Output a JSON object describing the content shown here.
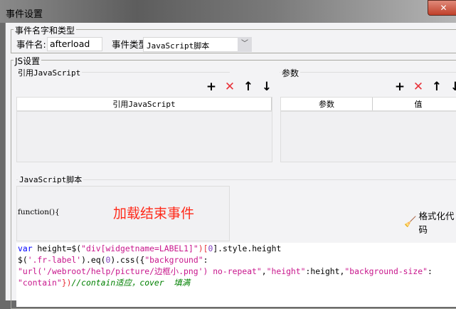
{
  "window": {
    "title": "事件设置",
    "close": "✕"
  },
  "event_group": {
    "title": "事件名字和类型",
    "name_label": "事件名:",
    "name_value": "afterload",
    "type_label": "事件类型:",
    "type_value": "JavaScript脚本"
  },
  "js_group": {
    "title": "JS设置",
    "ref_section": {
      "title": "引用JavaScript",
      "column": "引用JavaScript"
    },
    "param_section": {
      "title": "参数",
      "columns": [
        "参数",
        "值"
      ]
    },
    "toolbar": {
      "add": "+",
      "delete": "✕",
      "up": "↑",
      "down": "↓"
    },
    "script_section": {
      "title": "JavaScript脚本",
      "function_header": "function(){",
      "annotation": "加载结束事件",
      "format_button": "格式化代码"
    }
  },
  "code": {
    "l1": [
      "var",
      " height=$(",
      "\"div[widgetname=LABEL1]\"",
      ")[",
      "0",
      "].style.height"
    ],
    "l2": [
      "$(",
      "'.fr-label'",
      ").eq(",
      "0",
      ").css({",
      "\"background\"",
      ":"
    ],
    "l3": [
      "\"url('/webroot/help/picture/边框小.png') no-repeat\"",
      ",",
      "\"height\"",
      ":height,",
      "\"background-size\"",
      ":"
    ],
    "l4": [
      "\"contain\"",
      "})",
      "//contain适应，cover  填满"
    ]
  }
}
